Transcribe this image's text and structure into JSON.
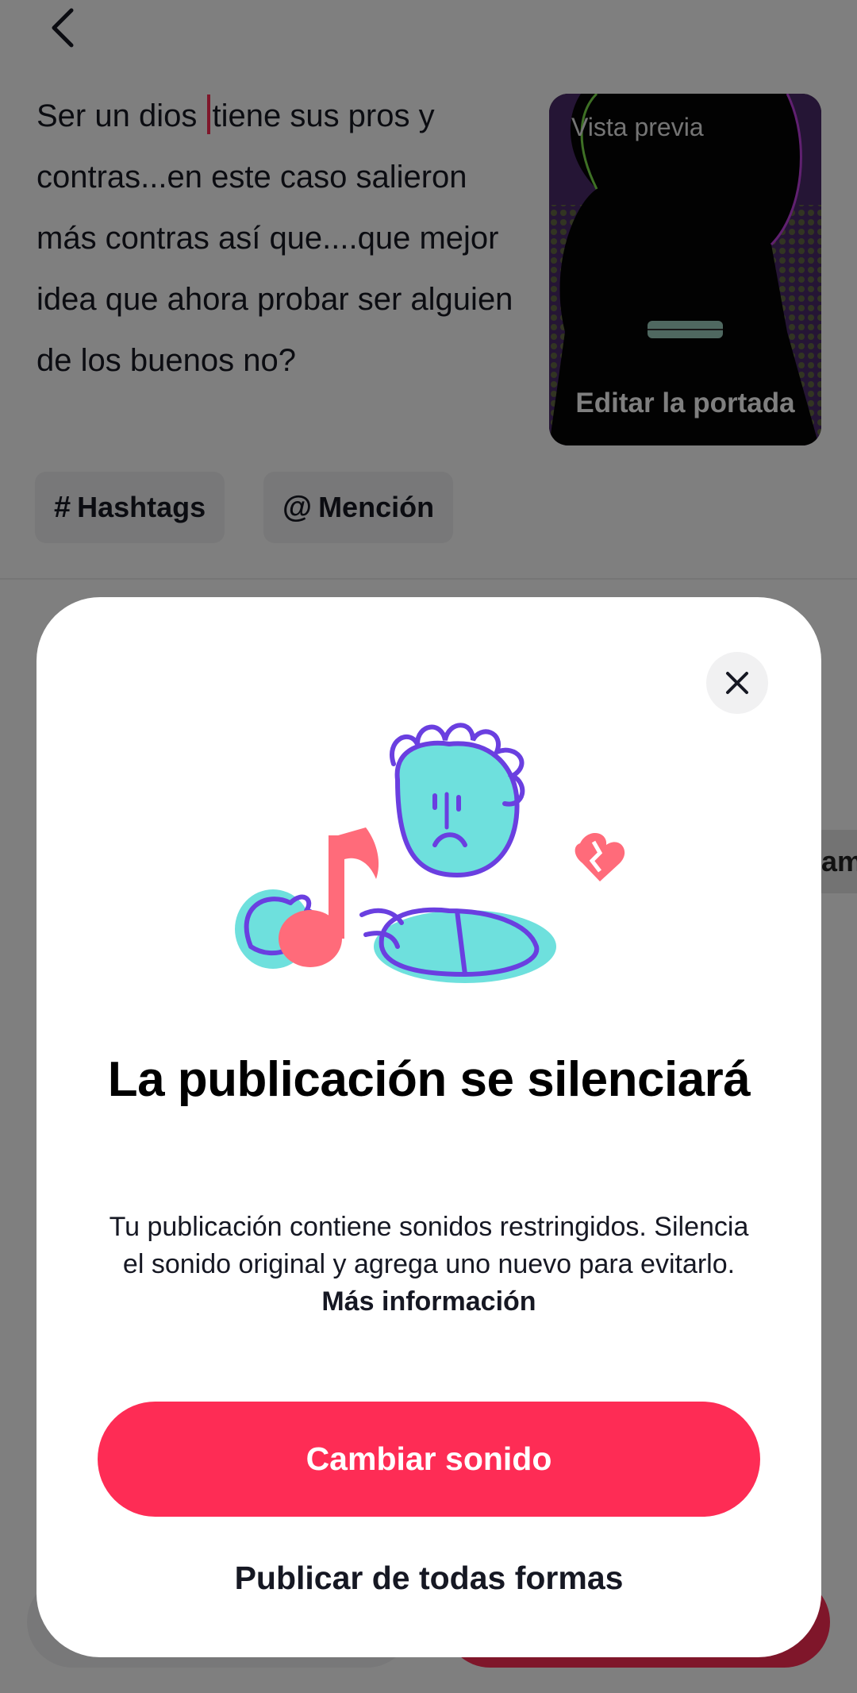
{
  "caption": {
    "before_caret": "Ser un dios ",
    "after_caret": "tiene sus pros y contras...en este caso salieron más contras así que....que mejor idea que ahora probar ser alguien de los buenos no?"
  },
  "cover": {
    "preview_label": "Vista previa",
    "edit_label": "Editar la portada"
  },
  "chips": {
    "hashtags_symbol": "#",
    "hashtags_label": "Hashtags",
    "mention_symbol": "@",
    "mention_label": "Mención"
  },
  "background": {
    "partial_right_text": "am"
  },
  "modal": {
    "title": "La publicación se silenciará",
    "body": "Tu publicación contiene sonidos restringidos. Silencia el sonido original y agrega uno nuevo para evitarlo. ",
    "more_info_link": "Más información",
    "primary_button": "Cambiar sonido",
    "secondary_button": "Publicar de todas formas"
  },
  "colors": {
    "accent": "#fe2c55",
    "illustration_cyan": "#6ee0dd",
    "illustration_purple": "#6a3fe0",
    "illustration_pink": "#ff6b7a"
  }
}
